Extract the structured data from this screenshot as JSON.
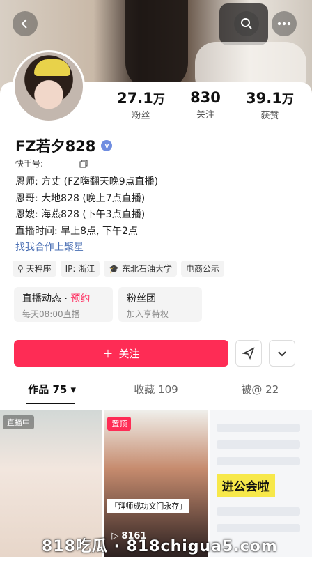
{
  "stats": {
    "fans_num": "27.1",
    "fans_unit": "万",
    "fans_label": "粉丝",
    "following_num": "830",
    "following_label": "关注",
    "likes_num": "39.1",
    "likes_unit": "万",
    "likes_label": "获赞"
  },
  "profile": {
    "name": "FZ若夕828",
    "kuaishou_label": "快手号:",
    "bio": [
      "恩师: 方丈 (FZ嗨翻天晚9点直播)",
      "恩哥: 大地828 (晚上7点直播)",
      "恩嫂: 海燕828 (下午3点直播)",
      "直播时间: 早上8点, 下午2点"
    ],
    "bio_link": "找我合作上聚星"
  },
  "tags": [
    "天秤座",
    "IP: 浙江",
    "东北石油大学",
    "电商公示"
  ],
  "boxes": {
    "live_title": "直播动态 · ",
    "live_highlight": "预约",
    "live_sub": "每天08:00直播",
    "fan_title": "粉丝团",
    "fan_sub": "加入享特权"
  },
  "actions": {
    "follow": "关注"
  },
  "tabs": [
    "作品 75",
    "收藏 109",
    "被@ 22"
  ],
  "tiles": {
    "live_badge": "直播中",
    "pin_badge": "置顶",
    "caption": "「拜师成功文门永存」",
    "views": "8161",
    "banner": "进公会啦"
  },
  "watermark": "818吃瓜 · 818chigua5.com",
  "colors": {
    "accent": "#fe2c55",
    "link": "#4a6fb4"
  }
}
